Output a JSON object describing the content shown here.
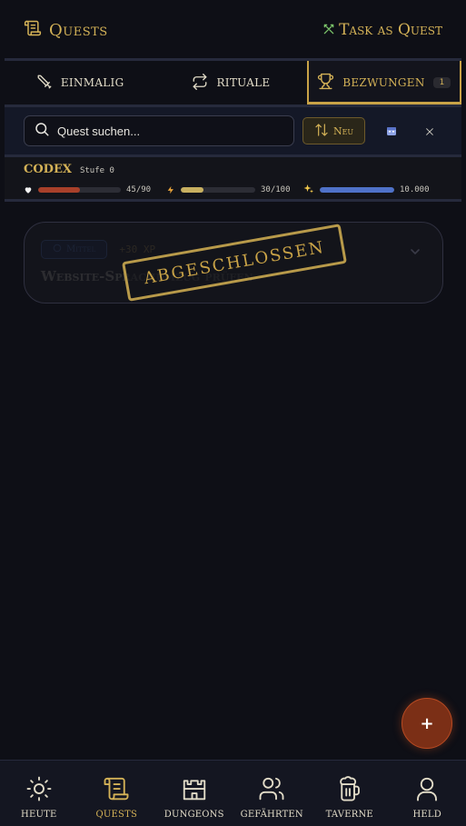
{
  "header": {
    "title": "Quests",
    "task_as_quest_label": "Task as Quest"
  },
  "tabs": [
    {
      "label": "Einmalig",
      "icon": "sword-icon"
    },
    {
      "label": "Rituale",
      "icon": "repeat-icon"
    },
    {
      "label": "Bezwungen",
      "icon": "trophy-icon",
      "badge": "1",
      "active": true
    }
  ],
  "toolbar": {
    "search_placeholder": "Quest suchen...",
    "sort_label": "Neu"
  },
  "hero": {
    "name": "CODEX",
    "level": "Stufe 0",
    "hp": {
      "text": "45/90",
      "fraction": 0.5,
      "color": "#a8402a"
    },
    "energy": {
      "text": "30/100",
      "fraction": 0.3,
      "color": "#c8b060"
    },
    "xp": {
      "text": "10.000",
      "fraction": 1.0,
      "color": "#4f72c9"
    }
  },
  "quest_card": {
    "difficulty": "Mittel",
    "xp_reward": "+30 XP",
    "title": "Website-Sprachumzug prüfen",
    "stamp": "Abgeschlossen"
  },
  "fab_label": "+",
  "nav": [
    {
      "label": "Heute",
      "icon": "sun-icon"
    },
    {
      "label": "Quests",
      "icon": "scroll-icon",
      "active": true
    },
    {
      "label": "Dungeons",
      "icon": "castle-icon"
    },
    {
      "label": "Gefährten",
      "icon": "users-icon"
    },
    {
      "label": "Taverne",
      "icon": "mug-icon"
    },
    {
      "label": "Held",
      "icon": "person-icon"
    }
  ]
}
